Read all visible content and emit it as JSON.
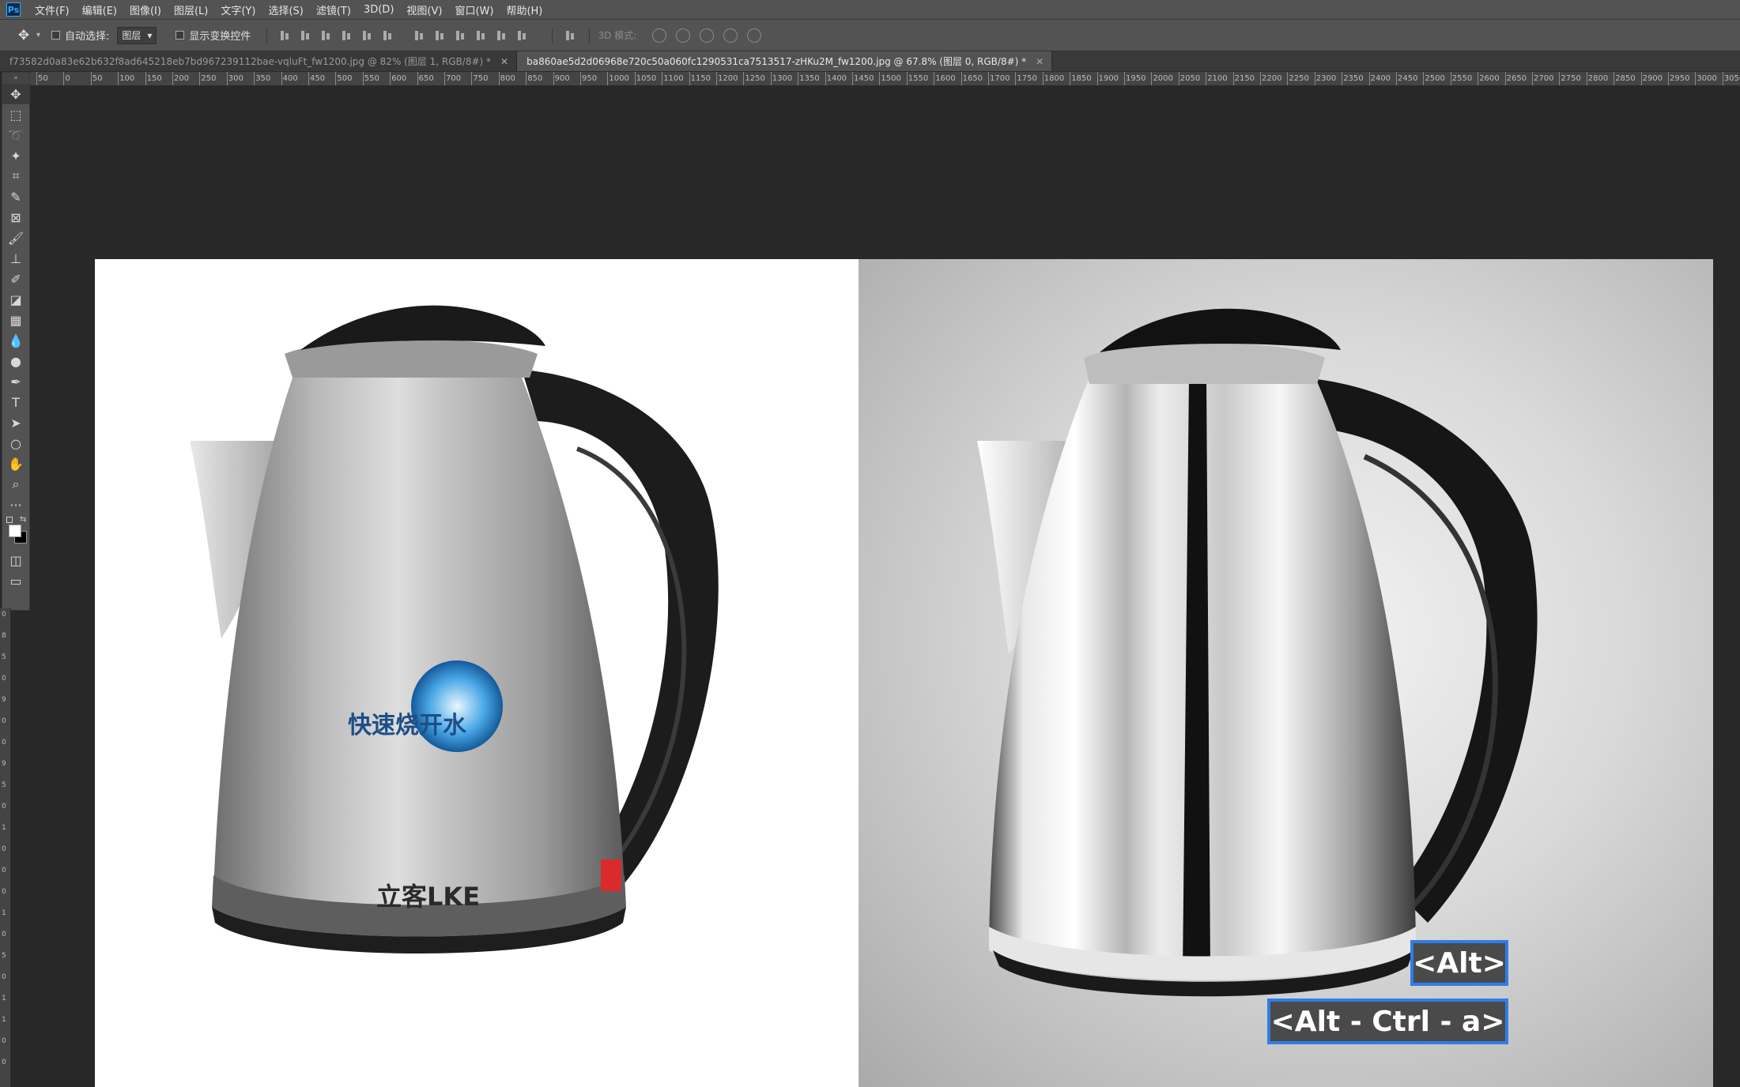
{
  "app": {
    "logo": "Ps"
  },
  "menu": [
    "文件(F)",
    "编辑(E)",
    "图像(I)",
    "图层(L)",
    "文字(Y)",
    "选择(S)",
    "滤镜(T)",
    "3D(D)",
    "视图(V)",
    "窗口(W)",
    "帮助(H)"
  ],
  "options": {
    "auto_select_label": "自动选择:",
    "auto_select_value": "图层",
    "show_transform_label": "显示变换控件",
    "mode_3d_label": "3D 模式:"
  },
  "tabs": [
    {
      "label": "f73582d0a83e62b632f8ad645218eb7bd967239112bae-vqluFt_fw1200.jpg @ 82% (图层 1, RGB/8#) *",
      "active": false
    },
    {
      "label": "ba860ae5d2d06968e720c50a060fc1290531ca7513517-zHKu2M_fw1200.jpg @ 67.8% (图层 0, RGB/8#) *",
      "active": true
    }
  ],
  "ruler_h_labels": [
    "50",
    "0",
    "50",
    "100",
    "150",
    "200",
    "250",
    "300",
    "350",
    "400",
    "450",
    "500",
    "550",
    "600",
    "650",
    "700",
    "750",
    "800",
    "850",
    "900",
    "950",
    "1000",
    "1050",
    "1100",
    "1150",
    "1200",
    "1250",
    "1300",
    "1350",
    "1400",
    "1450",
    "1500",
    "1550",
    "1600",
    "1650",
    "1700",
    "1750",
    "1800",
    "1850",
    "1900",
    "1950",
    "2000",
    "2050",
    "2100",
    "2150",
    "2200",
    "2250",
    "2300",
    "2350",
    "2400",
    "2450",
    "2500",
    "2550",
    "2600",
    "2650",
    "2700",
    "2750",
    "2800",
    "2850",
    "2900",
    "2950",
    "3000",
    "3050"
  ],
  "ruler_v_labels": [
    "0",
    "8",
    "5",
    "0",
    "9",
    "0",
    "0",
    "9",
    "5",
    "0",
    "1",
    "0",
    "0",
    "0",
    "1",
    "0",
    "5",
    "0",
    "1",
    "1",
    "0",
    "0"
  ],
  "kettle_left": {
    "logo_text": "立客LKE",
    "badge_text": "快速烧开水"
  },
  "overlays": {
    "alt": "<Alt>",
    "combo": "<Alt - Ctrl - a>"
  },
  "colors": {
    "chrome": "#535353",
    "workspace": "#282828",
    "overlay_border": "#2f7de8",
    "overlay_bg": "#4a4a4a"
  }
}
